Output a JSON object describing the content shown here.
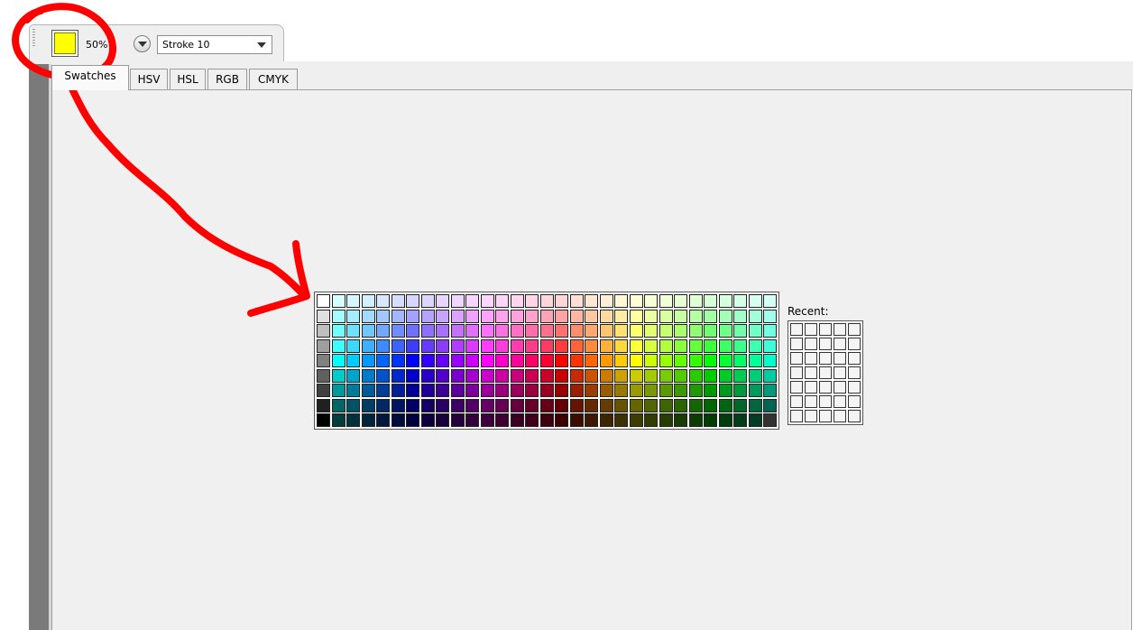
{
  "toolbar": {
    "current_color": "#ffff00",
    "opacity_label": "50%",
    "menu_button_icon": "chevron-down-icon",
    "stroke_value": "Stroke 10"
  },
  "tabs": [
    {
      "label": "Swatches",
      "active": true
    },
    {
      "label": "HSV",
      "active": false
    },
    {
      "label": "HSL",
      "active": false
    },
    {
      "label": "RGB",
      "active": false
    },
    {
      "label": "CMYK",
      "active": false
    }
  ],
  "swatches": {
    "columns": 31,
    "rows": 9
  },
  "recent": {
    "label": "Recent:",
    "columns": 5,
    "rows": 7
  },
  "annotation": {
    "color": "#ff0000",
    "description_icon": "red-circle-and-arrow"
  }
}
